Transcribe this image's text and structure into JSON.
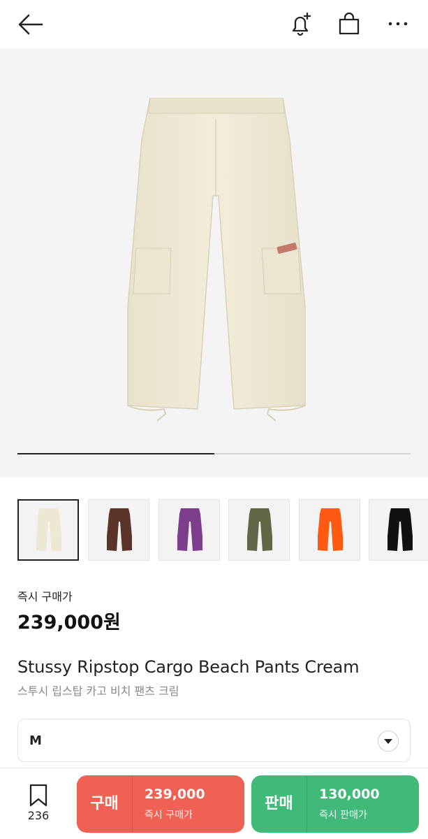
{
  "header": {
    "back_icon": "back-arrow-icon",
    "alert_icon": "bell-plus-icon",
    "bag_icon": "shopping-bag-icon",
    "more_icon": "more-dots-icon"
  },
  "gallery": {
    "progress": 0.5,
    "thumbnails": [
      {
        "color": "#ece8d4",
        "name": "cream"
      },
      {
        "color": "#5a3428",
        "name": "brown"
      },
      {
        "color": "#7b3d8c",
        "name": "purple"
      },
      {
        "color": "#5f6747",
        "name": "olive"
      },
      {
        "color": "#ff5a14",
        "name": "orange"
      },
      {
        "color": "#111111",
        "name": "black"
      }
    ]
  },
  "product": {
    "price_label": "즉시 구매가",
    "price": "239,000원",
    "name_en": "Stussy Ripstop Cargo Beach Pants Cream",
    "name_ko": "스투시 립스탑 카고 비치 팬츠 크림"
  },
  "size_select": {
    "value": "M"
  },
  "bottom": {
    "bookmark_count": "236",
    "buy": {
      "label": "구매",
      "amount": "239,000",
      "sub": "즉시 구매가",
      "color": "#ef6253"
    },
    "sell": {
      "label": "판매",
      "amount": "130,000",
      "sub": "즉시 판매가",
      "color": "#41b979"
    }
  }
}
